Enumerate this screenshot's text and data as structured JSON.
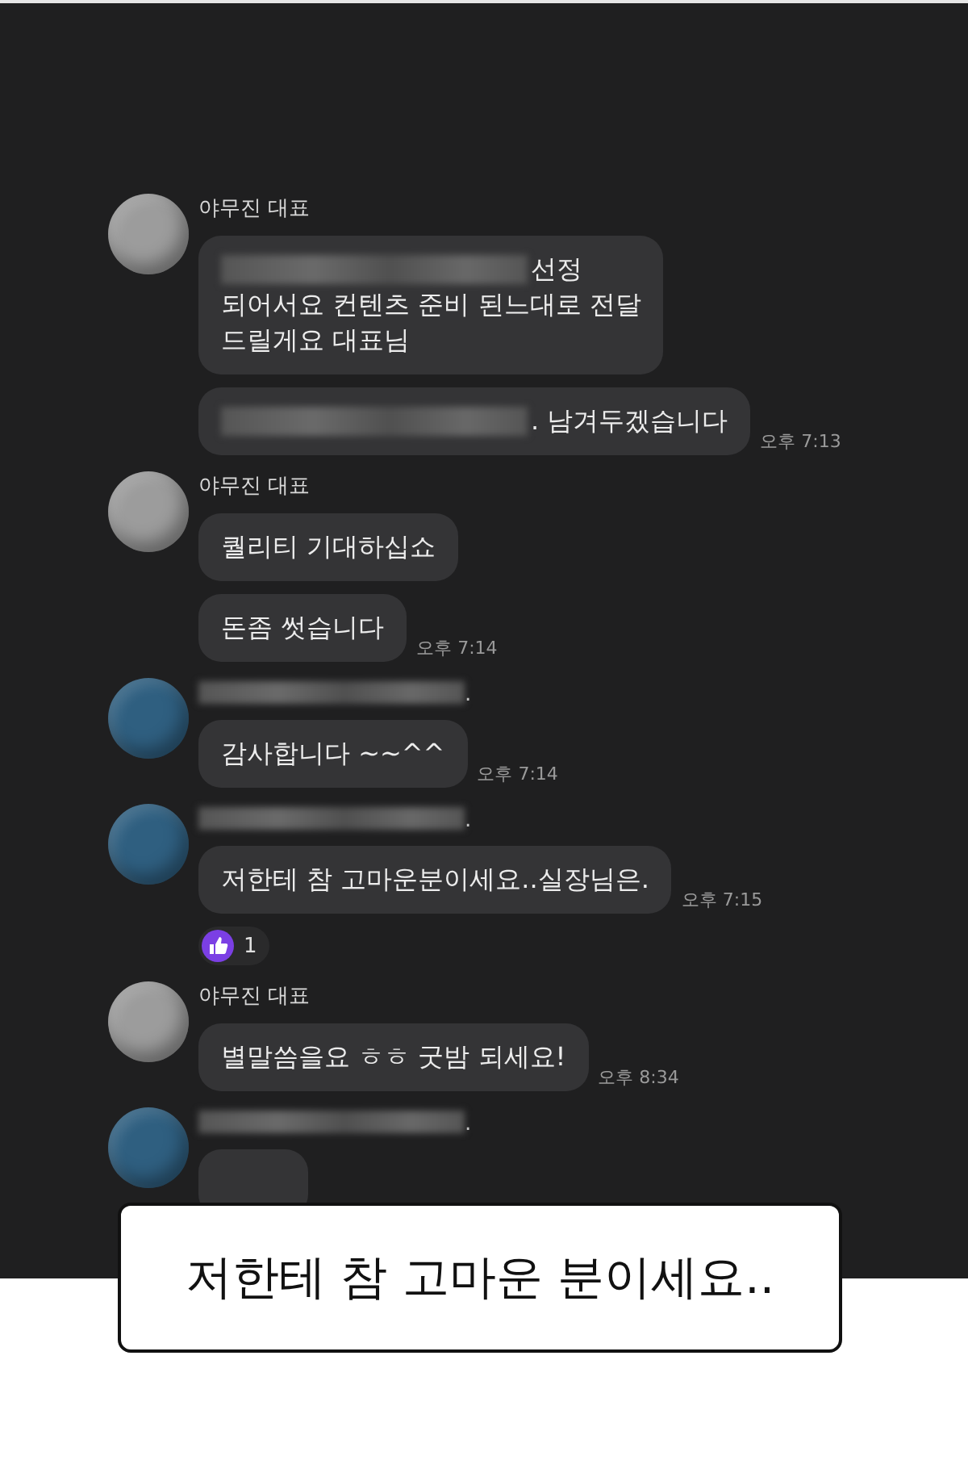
{
  "chat": {
    "groups": [
      {
        "color": "#9c9c9c",
        "sender": {
          "text": "야무진 대표",
          "redacted": false
        },
        "messages": [
          {
            "kind": "text",
            "lines": [
              {
                "text": "선정",
                "redacted": true
              },
              {
                "text": "되어서요 컨텐츠 준비 된느대로 전달",
                "redacted": false
              },
              {
                "text": "드릴게요 대표님",
                "redacted": false
              }
            ]
          },
          {
            "kind": "text",
            "lines": [
              {
                "text": ". 남겨두겠습니다",
                "redacted": true
              }
            ],
            "time": "오후 7:13"
          }
        ]
      },
      {
        "color": "#9c9c9c",
        "sender": {
          "text": "야무진 대표",
          "redacted": false
        },
        "messages": [
          {
            "kind": "text",
            "lines": [
              {
                "text": "퀄리티 기대하십쇼",
                "redacted": false
              }
            ]
          },
          {
            "kind": "text",
            "lines": [
              {
                "text": "돈좀 썻습니다",
                "redacted": false
              }
            ],
            "time": "오후 7:14"
          }
        ]
      },
      {
        "color": "#2f5f80",
        "sender": {
          "text": ".",
          "redacted": true
        },
        "messages": [
          {
            "kind": "text",
            "lines": [
              {
                "text": "감사합니다 ~~^^",
                "redacted": false
              }
            ],
            "time": "오후 7:14"
          }
        ]
      },
      {
        "color": "#2f5f80",
        "sender": {
          "text": ".",
          "redacted": true
        },
        "messages": [
          {
            "kind": "text",
            "lines": [
              {
                "text": "저한테 참 고마운분이세요..실장님은.",
                "redacted": false
              }
            ],
            "time": "오후 7:15"
          }
        ],
        "reaction": {
          "count": "1"
        }
      },
      {
        "color": "#9c9c9c",
        "sender": {
          "text": "야무진 대표",
          "redacted": false
        },
        "messages": [
          {
            "kind": "text",
            "lines": [
              {
                "text": "별말씀을요 ㅎㅎ 굿밤 되세요!",
                "redacted": false
              }
            ],
            "time": "오후 8:34"
          }
        ]
      },
      {
        "color": "#2f5f80",
        "sender": {
          "text": ".",
          "redacted": true
        },
        "messages": [
          {
            "kind": "covered"
          }
        ]
      }
    ]
  },
  "caption": {
    "text": "저한테 참 고마운 분이세요.."
  }
}
